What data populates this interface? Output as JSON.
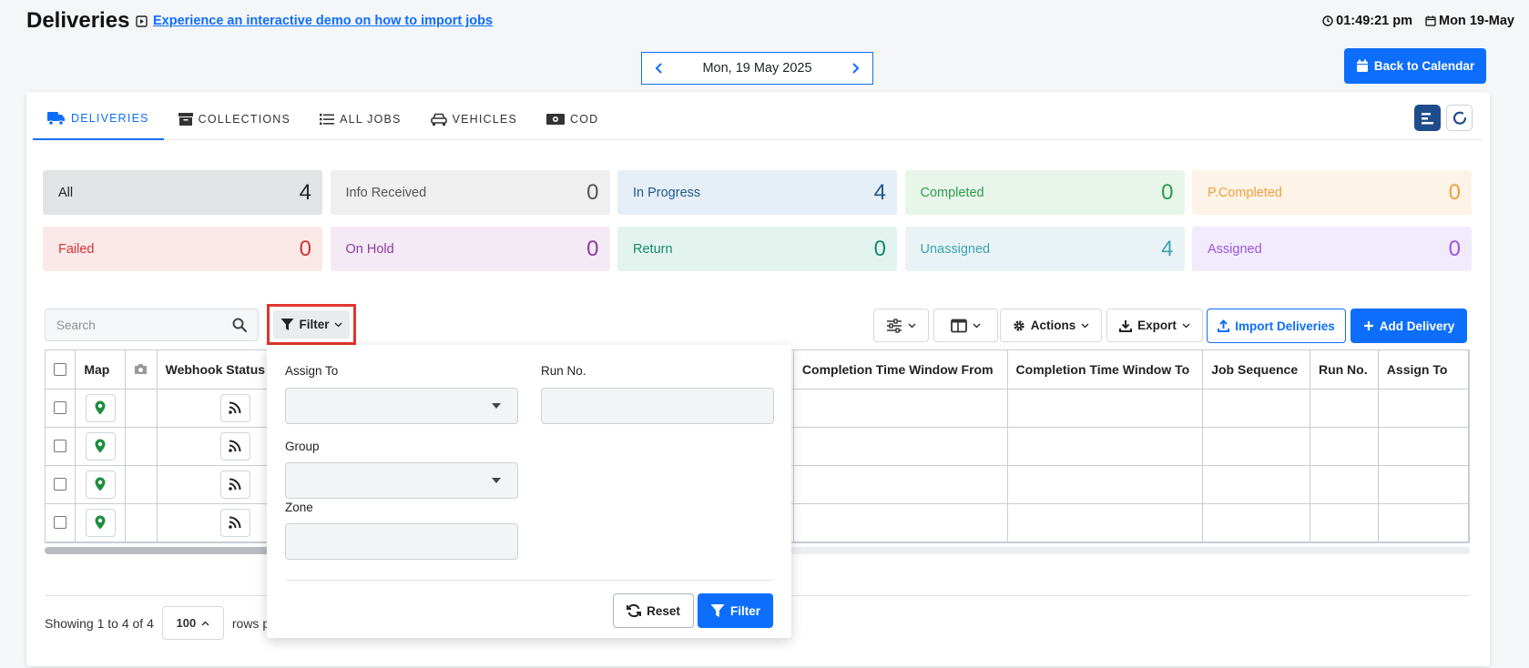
{
  "header": {
    "title": "Deliveries",
    "demo_link": "Experience an interactive demo on how to import jobs",
    "time": "01:49:21 pm",
    "date": "Mon 19-May"
  },
  "date_nav": {
    "label": "Mon, 19 May 2025"
  },
  "back_calendar": "Back to Calendar",
  "tabs": [
    {
      "label": "DELIVERIES",
      "icon": "truck-icon",
      "active": true
    },
    {
      "label": "COLLECTIONS",
      "icon": "archive-box-icon",
      "active": false
    },
    {
      "label": "ALL JOBS",
      "icon": "list-icon",
      "active": false
    },
    {
      "label": "VEHICLES",
      "icon": "car-icon",
      "active": false
    },
    {
      "label": "COD",
      "icon": "money-icon",
      "active": false
    }
  ],
  "status_cards": [
    {
      "label": "All",
      "count": "4",
      "bg": "#e2e3e5",
      "color": "#212529"
    },
    {
      "label": "Info Received",
      "count": "0",
      "bg": "#efefef",
      "color": "#555555"
    },
    {
      "label": "In Progress",
      "count": "4",
      "bg": "#e6eef7",
      "color": "#1c5a8f"
    },
    {
      "label": "Completed",
      "count": "0",
      "bg": "#e8f5ea",
      "color": "#2e9a4a"
    },
    {
      "label": "P.Completed",
      "count": "0",
      "bg": "#fdf3e6",
      "color": "#f0a040"
    },
    {
      "label": "Failed",
      "count": "0",
      "bg": "#fbe8e8",
      "color": "#d63333"
    },
    {
      "label": "On Hold",
      "count": "0",
      "bg": "#f4eaf5",
      "color": "#8e3aa0"
    },
    {
      "label": "Return",
      "count": "0",
      "bg": "#e3f4ef",
      "color": "#138a6a"
    },
    {
      "label": "Unassigned",
      "count": "4",
      "bg": "#e9f3f5",
      "color": "#3aa3b3"
    },
    {
      "label": "Assigned",
      "count": "0",
      "bg": "#f1ebfb",
      "color": "#9a55e0"
    }
  ],
  "toolbar": {
    "search_placeholder": "Search",
    "filter": "Filter",
    "actions": "Actions",
    "export": "Export",
    "import": "Import Deliveries",
    "add": "Add Delivery"
  },
  "table": {
    "left_headers": [
      "Map",
      "Webhook Status"
    ],
    "right_headers": [
      "Completion Time Window From",
      "Completion Time Window To",
      "Job Sequence",
      "Run No.",
      "Assign To"
    ],
    "row_count": 4
  },
  "footer": {
    "showing": "Showing 1 to 4 of 4",
    "page_size": "100",
    "rows_per": "rows pe"
  },
  "filter_panel": {
    "assign_to": "Assign To",
    "run_no": "Run No.",
    "group": "Group",
    "zone": "Zone",
    "reset": "Reset",
    "apply": "Filter"
  },
  "colors": {
    "accent": "#0d6efd",
    "highlight": "#e3342f",
    "map_pin": "#1e8e3e"
  }
}
